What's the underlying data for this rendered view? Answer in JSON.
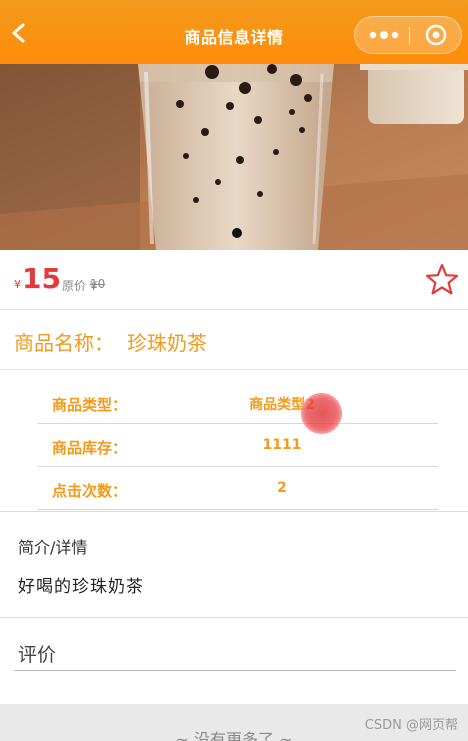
{
  "nav": {
    "title": "商品信息详情",
    "accent": "#ff8c0a"
  },
  "banner": {
    "carousel_active_index": 1
  },
  "price": {
    "currency": "¥",
    "current": "15",
    "original_label": "原价 ¥",
    "original": "10",
    "color": "#e4393c"
  },
  "product": {
    "name_label": "商品名称：",
    "name": "珍珠奶茶"
  },
  "info_rows": [
    {
      "key": "商品类型：",
      "value": "商品类型2"
    },
    {
      "key": "商品库存：",
      "value": "1111"
    },
    {
      "key": "点击次数：",
      "value": "2"
    }
  ],
  "description": {
    "title": "简介/详情",
    "text": "好喝的珍珠奶茶"
  },
  "review": {
    "title": "评价"
  },
  "footer": {
    "text": "~ 没有更多了 ~"
  },
  "watermark": "CSDN @网页帮",
  "icons": [
    "back-arrow-icon",
    "more-dots-icon",
    "target-icon",
    "star-icon"
  ]
}
